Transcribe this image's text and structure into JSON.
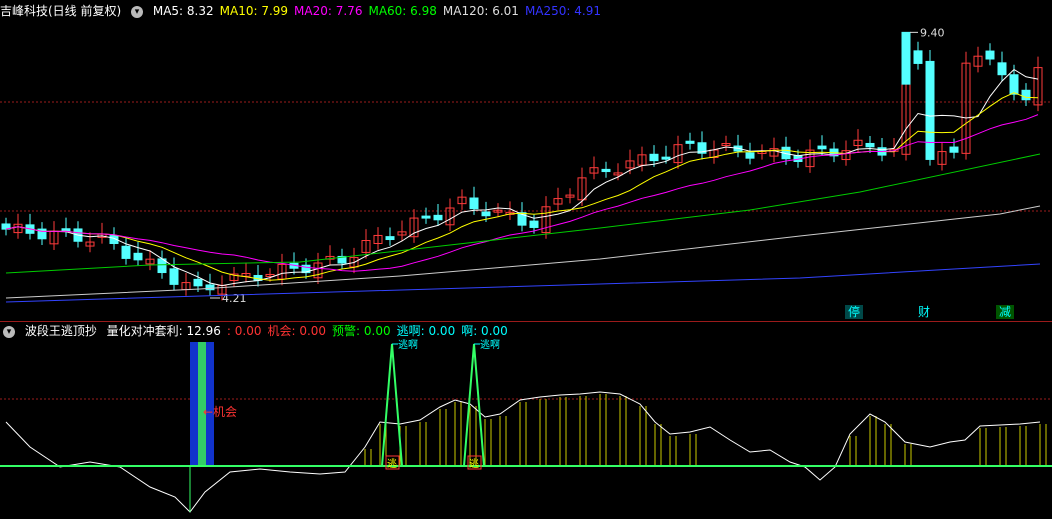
{
  "main": {
    "title": "吉峰科技(日线 前复权)",
    "mas": [
      {
        "label": "MA5:",
        "value": "8.32",
        "color": "#ffffff"
      },
      {
        "label": "MA10:",
        "value": "7.99",
        "color": "#ffff00"
      },
      {
        "label": "MA20:",
        "value": "7.76",
        "color": "#ff00ff"
      },
      {
        "label": "MA60:",
        "value": "6.98",
        "color": "#00ff00"
      },
      {
        "label": "MA120:",
        "value": "6.01",
        "color": "#dddddd"
      },
      {
        "label": "MA250:",
        "value": "4.91",
        "color": "#3333ff"
      }
    ],
    "high_label": "9.40",
    "low_label": "4.21",
    "tags": [
      "停",
      "财",
      "减"
    ]
  },
  "sub": {
    "title": "波段王逃顶抄",
    "indicators": [
      {
        "label": "量化对冲套利:",
        "value": "12.96",
        "color": "#ffffff"
      },
      {
        "label": ":",
        "value": "0.00",
        "color": "#ff3333"
      },
      {
        "label": "机会:",
        "value": "0.00",
        "color": "#ff3333"
      },
      {
        "label": "预警:",
        "value": "0.00",
        "color": "#00ff00"
      },
      {
        "label": "逃啊:",
        "value": "0.00",
        "color": "#00ffff"
      },
      {
        "label": "啊:",
        "value": "0.00",
        "color": "#00ffff"
      }
    ],
    "chance_label": "机会",
    "escape_top_label": "逃啊",
    "escape_bottom_label": "逃"
  },
  "colors": {
    "up": "#ff3b3b",
    "down": "#54ffff",
    "grid": "#9b1b1b"
  }
}
